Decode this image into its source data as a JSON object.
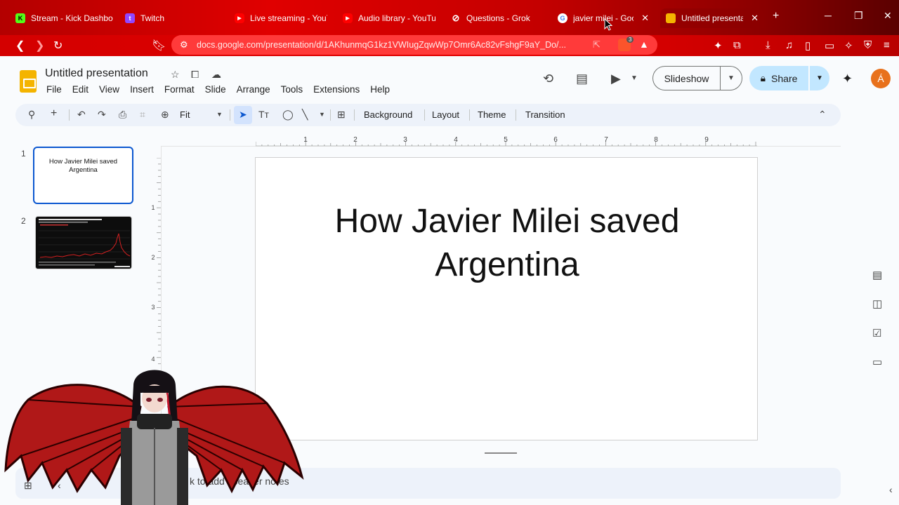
{
  "browser": {
    "tabs": [
      {
        "label": "Stream - Kick Dashbo",
        "icon": "kick-icon",
        "color": "#53fc18",
        "glyph": "K"
      },
      {
        "label": "Twitch",
        "icon": "twitch-icon",
        "color": "#9146ff",
        "glyph": "t"
      },
      {
        "label": "Live streaming - YouT",
        "icon": "youtube-icon",
        "color": "#ff0000",
        "glyph": "▶"
      },
      {
        "label": "Audio library - YouTu",
        "icon": "youtube-icon",
        "color": "#ff0000",
        "glyph": "▶"
      },
      {
        "label": "Questions - Grok",
        "icon": "grok-icon",
        "color": "transparent",
        "glyph": "⊘"
      },
      {
        "label": "javier milei - Goo",
        "icon": "google-icon",
        "color": "#ffffff",
        "glyph": "G"
      },
      {
        "label": "Untitled presenta",
        "icon": "slides-icon",
        "color": "#f4b400",
        "glyph": ""
      }
    ],
    "url": "docs.google.com/presentation/d/1AKhunmqG1kz1VWIugZqwWp7Omr6Ac82vFshgF9aY_Do/...",
    "brave_badge": "3"
  },
  "app": {
    "title": "Untitled presentation",
    "menu": [
      "File",
      "Edit",
      "View",
      "Insert",
      "Format",
      "Slide",
      "Arrange",
      "Tools",
      "Extensions",
      "Help"
    ],
    "slideshow_label": "Slideshow",
    "share_label": "Share",
    "avatar_initial": "Á",
    "accent": "#0b57d0"
  },
  "toolbar": {
    "zoom": "Fit",
    "background": "Background",
    "layout": "Layout",
    "theme": "Theme",
    "transition": "Transition"
  },
  "filmstrip": {
    "slides": [
      {
        "number": "1",
        "title": "How  Javier Milei saved Argentina"
      },
      {
        "number": "2"
      }
    ]
  },
  "ruler": {
    "h_marks": [
      "1",
      "2",
      "3",
      "4",
      "5",
      "6",
      "7",
      "8",
      "9"
    ],
    "v_marks": [
      "1",
      "2",
      "3",
      "4"
    ]
  },
  "slide": {
    "title_line1": "How  Javier Milei saved",
    "title_line2": "Argentina"
  },
  "notes": {
    "placeholder": "k to add speaker notes"
  }
}
